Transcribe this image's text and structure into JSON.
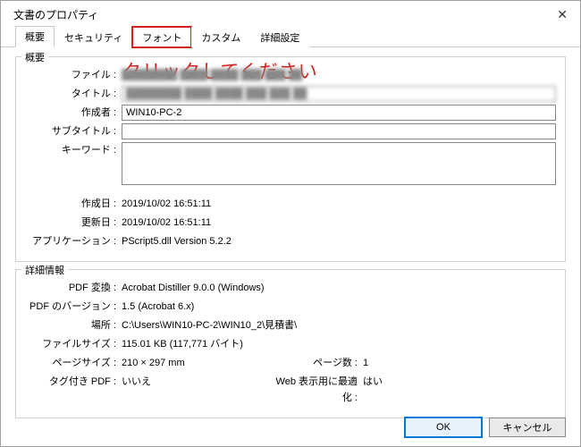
{
  "title": "文書のプロパティ",
  "tabs": {
    "summary": "概要",
    "security": "セキュリティ",
    "fonts": "フォント",
    "custom": "カスタム",
    "advanced": "詳細設定"
  },
  "annotation": "クリックしてください",
  "summary_group": {
    "title": "概要",
    "labels": {
      "file": "ファイル :",
      "title": "タイトル :",
      "author": "作成者 :",
      "subtitle": "サブタイトル :",
      "keywords": "キーワード :",
      "created": "作成日 :",
      "modified": "更新日 :",
      "application": "アプリケーション :"
    },
    "values": {
      "file_blurred": "████████ ████ ████ ███ ███ ██",
      "title_blurred": "████████ ████ ████ ███ ███ ██",
      "author": "WIN10-PC-2",
      "created": "2019/10/02 16:51:11",
      "modified": "2019/10/02 16:51:11",
      "application": "PScript5.dll Version 5.2.2"
    }
  },
  "details_group": {
    "title": "詳細情報",
    "labels": {
      "pdf_producer": "PDF 変換 :",
      "pdf_version": "PDF のバージョン :",
      "location": "場所 :",
      "file_size": "ファイルサイズ :",
      "page_size": "ページサイズ :",
      "page_count": "ページ数 :",
      "tagged_pdf": "タグ付き PDF :",
      "fast_web": "Web 表示用に最適化 :"
    },
    "values": {
      "pdf_producer": "Acrobat Distiller 9.0.0 (Windows)",
      "pdf_version": "1.5 (Acrobat 6.x)",
      "location": "C:\\Users\\WIN10-PC-2\\WIN10_2\\見積書\\",
      "file_size": "115.01 KB (117,771 バイト)",
      "page_size": "210 × 297 mm",
      "page_count": "1",
      "tagged_pdf": "いいえ",
      "fast_web": "はい"
    }
  },
  "buttons": {
    "ok": "OK",
    "cancel": "キャンセル"
  }
}
